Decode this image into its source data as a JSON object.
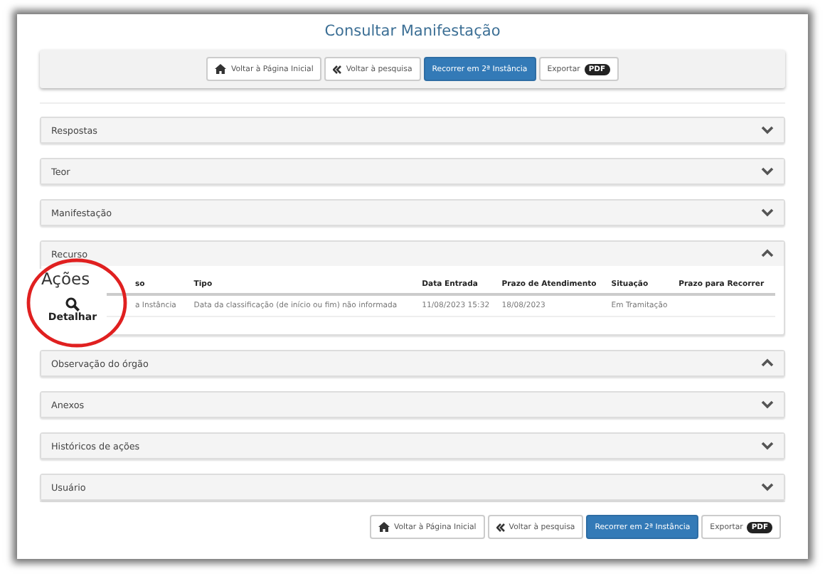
{
  "title": "Consultar Manifestação",
  "toolbar": [
    {
      "label": "Voltar à Página Inicial",
      "kind": "default"
    },
    {
      "label": "Voltar à pesquisa",
      "kind": "default"
    },
    {
      "label": "Recorrer em 2ª Instância",
      "kind": "primary"
    },
    {
      "label": "Exportar",
      "badge": "PDF",
      "kind": "default"
    }
  ],
  "panels": [
    {
      "title": "Respostas",
      "expanded": false
    },
    {
      "title": "Teor",
      "expanded": false
    },
    {
      "title": "Manifestação",
      "expanded": false
    },
    {
      "title": "Recurso",
      "expanded": true,
      "table": {
        "columns": [
          "so",
          "Tipo",
          "Data Entrada",
          "Prazo de Atendimento",
          "Situação",
          "Prazo para Recorrer"
        ],
        "rows": [
          [
            "a Instância",
            "Data da classificação (de início ou fim) não informada",
            "11/08/2023 15:32",
            "18/08/2023",
            "Em Tramitação",
            ""
          ]
        ]
      },
      "callout": {
        "heading": "Ações",
        "action": "Detalhar"
      }
    },
    {
      "title": "Observação do órgão",
      "expanded": true
    },
    {
      "title": "Anexos",
      "expanded": false
    },
    {
      "title": "Históricos de ações",
      "expanded": false
    },
    {
      "title": "Usuário",
      "expanded": false
    }
  ],
  "footer_buttons": [
    {
      "label": "Voltar à Página Inicial",
      "kind": "default"
    },
    {
      "label": "Voltar à pesquisa",
      "kind": "default"
    },
    {
      "label": "Recorrer em 2ª Instância",
      "kind": "primary"
    },
    {
      "label": "Exportar",
      "badge": "PDF",
      "kind": "default"
    }
  ]
}
